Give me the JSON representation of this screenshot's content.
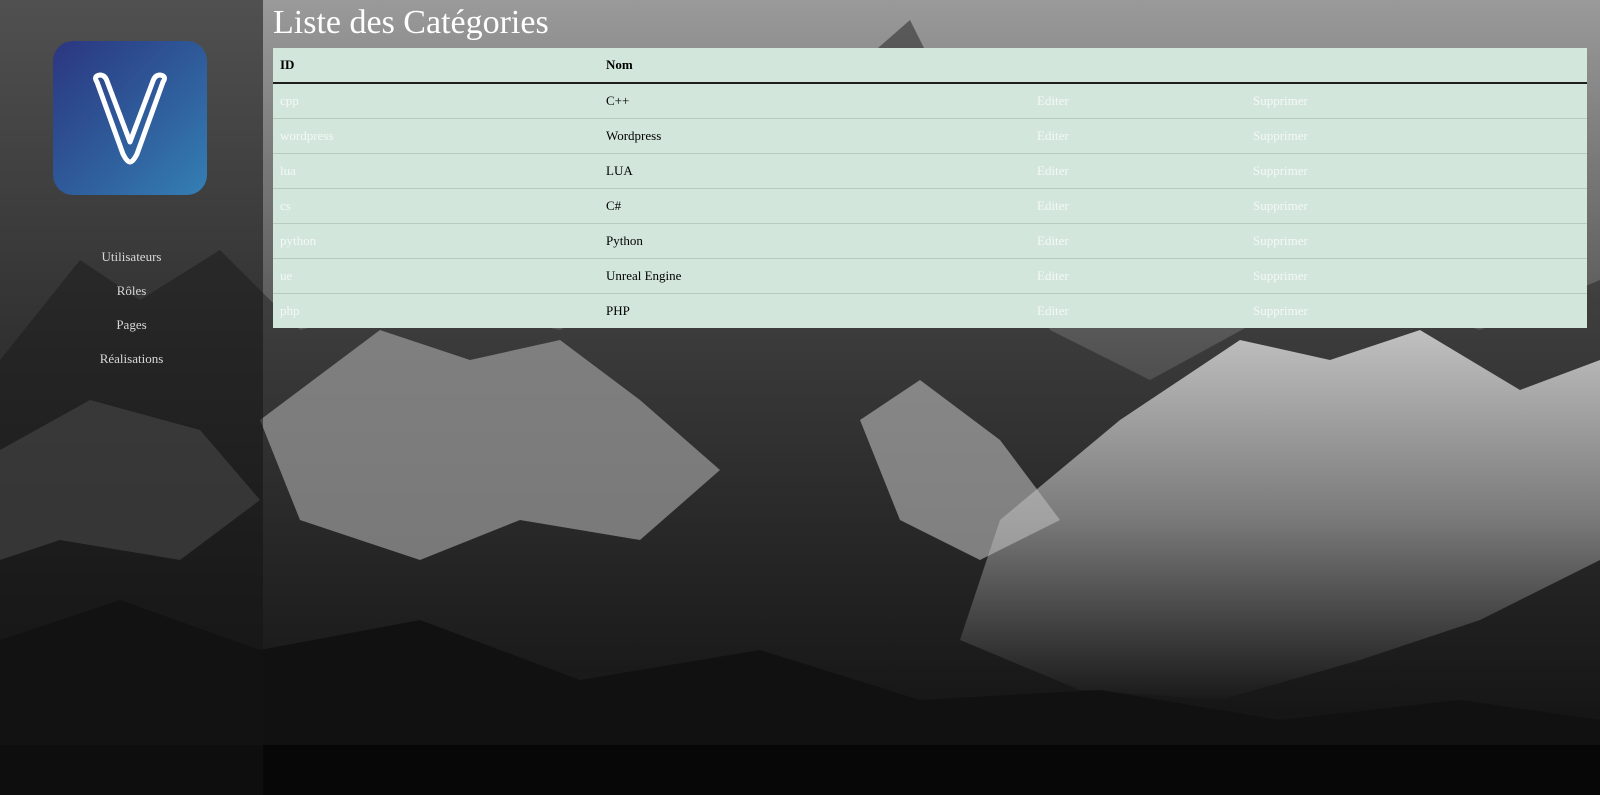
{
  "page": {
    "title": "Liste des Catégories"
  },
  "brand": {
    "logo_letter": "V",
    "logo_gradient": [
      "#2b3680",
      "#347fb4"
    ]
  },
  "sidebar": {
    "items": [
      {
        "label": "Utilisateurs"
      },
      {
        "label": "Rôles"
      },
      {
        "label": "Pages"
      },
      {
        "label": "Réalisations"
      }
    ]
  },
  "table": {
    "headers": [
      "ID",
      "Nom",
      "",
      ""
    ],
    "rows": [
      {
        "id": "cpp",
        "name": "C++",
        "edit": "Editer",
        "delete": "Supprimer"
      },
      {
        "id": "wordpress",
        "name": "Wordpress",
        "edit": "Editer",
        "delete": "Supprimer"
      },
      {
        "id": "lua",
        "name": "LUA",
        "edit": "Editer",
        "delete": "Supprimer"
      },
      {
        "id": "cs",
        "name": "C#",
        "edit": "Editer",
        "delete": "Supprimer"
      },
      {
        "id": "python",
        "name": "Python",
        "edit": "Editer",
        "delete": "Supprimer"
      },
      {
        "id": "ue",
        "name": "Unreal Engine",
        "edit": "Editer",
        "delete": "Supprimer"
      },
      {
        "id": "php",
        "name": "PHP",
        "edit": "Editer",
        "delete": "Supprimer"
      }
    ]
  },
  "colors": {
    "table_bg": "#d3e6dc",
    "link_text": "#f4f8f6",
    "header_text": "#ffffff"
  }
}
